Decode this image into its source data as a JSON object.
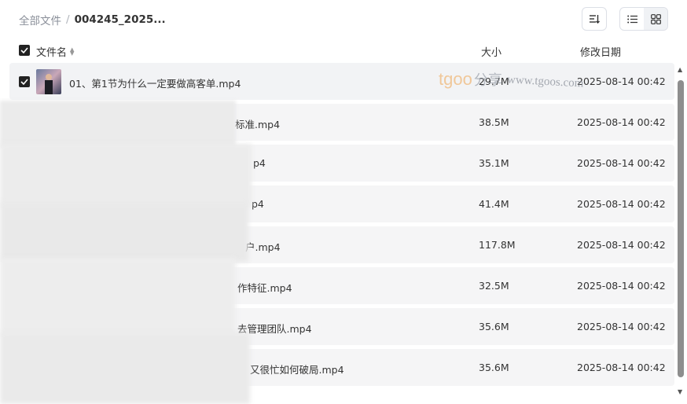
{
  "breadcrumb": {
    "root": "全部文件",
    "separator": "/",
    "current": "004245_2025..."
  },
  "toolbar": {
    "sort_icon": "sort-icon",
    "list_icon": "list-view-icon",
    "grid_icon": "grid-view-icon"
  },
  "header": {
    "name": "文件名",
    "size": "大小",
    "date": "修改日期"
  },
  "watermark": {
    "logo": "tgoo",
    "cn": "分享",
    "url": "www.tgoos.com"
  },
  "files": [
    {
      "name": "01、第1节为什么一定要做高客单.mp4",
      "size": "29.7M",
      "date": "2025-08-14 00:42"
    },
    {
      "name": "标准.mp4",
      "size": "38.5M",
      "date": "2025-08-14 00:42"
    },
    {
      "name": "p4",
      "size": "35.1M",
      "date": "2025-08-14 00:42"
    },
    {
      "name": "p4",
      "size": "41.4M",
      "date": "2025-08-14 00:42"
    },
    {
      "name": "户.mp4",
      "size": "117.8M",
      "date": "2025-08-14 00:42"
    },
    {
      "name": "作特征.mp4",
      "size": "32.5M",
      "date": "2025-08-14 00:42"
    },
    {
      "name": "去管理团队.mp4",
      "size": "35.6M",
      "date": "2025-08-14 00:42"
    },
    {
      "name": "又很忙如何破局.mp4",
      "size": "35.6M",
      "date": "2025-08-14 00:42"
    }
  ],
  "colors": {
    "accent": "#222222",
    "row_bg": "#f5f5f6",
    "scroll_thumb": "#8e8e8e"
  }
}
